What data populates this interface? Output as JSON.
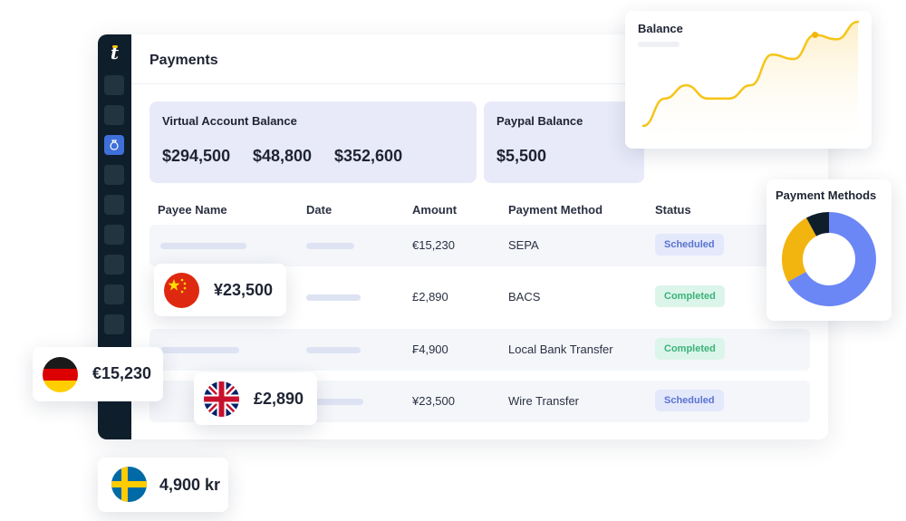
{
  "app": {
    "logo_letter": "t",
    "page_title": "Payments"
  },
  "sidebar": {
    "items": [
      "nav-item-1",
      "nav-item-2",
      "nav-item-3",
      "nav-item-4",
      "nav-item-5",
      "nav-item-6",
      "nav-item-7",
      "nav-item-8",
      "nav-item-9",
      "nav-item-10"
    ],
    "active_icon": "payments-icon"
  },
  "balances": {
    "virtual_label": "Virtual Account Balance",
    "virtual_amounts": [
      "$294,500",
      "$48,800",
      "$352,600"
    ],
    "paypal_label": "Paypal Balance",
    "paypal_amount": "$5,500"
  },
  "table": {
    "headers": [
      "Payee Name",
      "Date",
      "Amount",
      "Payment Method",
      "Status"
    ],
    "rows": [
      {
        "amount": "€15,230",
        "method": "SEPA",
        "status": "Scheduled"
      },
      {
        "amount": "£2,890",
        "method": "BACS",
        "status": "Completed"
      },
      {
        "amount": "₣4,900",
        "method": "Local Bank Transfer",
        "status": "Completed"
      },
      {
        "amount": "¥23,500",
        "method": "Wire Transfer",
        "status": "Scheduled"
      }
    ]
  },
  "currency_cards": [
    {
      "flag": "china-flag-icon",
      "amount": "¥23,500"
    },
    {
      "flag": "germany-flag-icon",
      "amount": "€15,230"
    },
    {
      "flag": "uk-flag-icon",
      "amount": "£2,890"
    },
    {
      "flag": "sweden-flag-icon",
      "amount": "4,900 kr"
    }
  ],
  "balance_chart": {
    "title": "Balance",
    "chart_data": {
      "type": "line",
      "title": "Balance",
      "values": [
        0.05,
        0.3,
        0.42,
        0.3,
        0.3,
        0.42,
        0.7,
        0.66,
        0.88,
        0.84,
        1.0
      ],
      "highlight_index": 8,
      "color": "#f5c518",
      "fill_color": "#fdf3d8"
    }
  },
  "methods_chart": {
    "title": "Payment Methods",
    "chart_data": {
      "type": "pie",
      "title": "Payment Methods",
      "slices": [
        {
          "value": 0.67,
          "color": "#6b86f5"
        },
        {
          "value": 0.25,
          "color": "#f2b40f"
        },
        {
          "value": 0.08,
          "color": "#0f1e2b"
        }
      ]
    }
  },
  "colors": {
    "sidebar": "#0f1e2b",
    "accent": "#3f6fd9",
    "card_bg": "#e8eaf9",
    "scheduled": "#5a74d0",
    "completed": "#3bb27a"
  }
}
